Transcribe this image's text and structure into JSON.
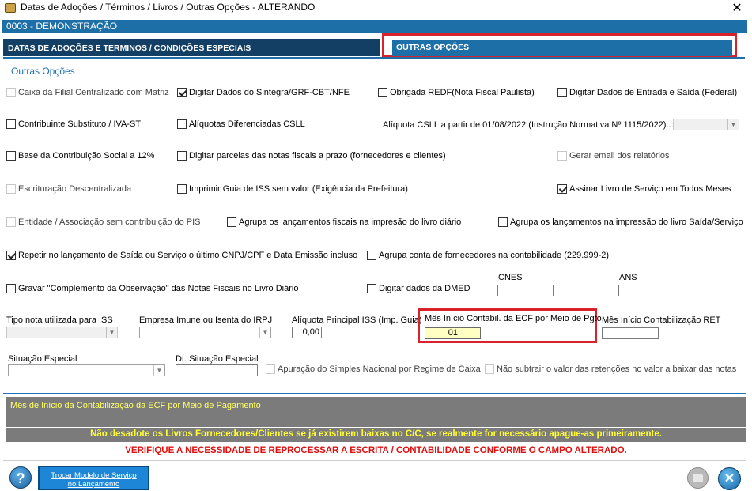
{
  "window": {
    "title": "Datas de Adoções / Términos / Livros / Outras Opções   -   ALTERANDO",
    "close_glyph": "✕"
  },
  "company_bar": "0003   -   DEMONSTRAÇÃO",
  "tabs": [
    {
      "label": "DATAS DE ADOÇÕES E TERMINOS / CONDIÇÕES ESPECIAIS"
    },
    {
      "label": "OUTRAS OPÇÕES"
    }
  ],
  "section_title": "Outras Opções",
  "checkboxes": {
    "caixa_filial": {
      "label": "Caixa da Filial Centralizado com Matriz",
      "checked": false,
      "enabled": false
    },
    "sintegra": {
      "label": "Digitar Dados do Sintegra/GRF-CBT/NFE",
      "checked": true,
      "enabled": true
    },
    "redf": {
      "label": "Obrigada REDF(Nota Fiscal Paulista)",
      "checked": false,
      "enabled": true
    },
    "entrada_saida": {
      "label": "Digitar Dados de Entrada e Saída (Federal)",
      "checked": false,
      "enabled": true
    },
    "contribuinte": {
      "label": "Contribuinte Substituto / IVA-ST",
      "checked": false,
      "enabled": true
    },
    "aliquotas_csll": {
      "label": "Alíquotas Diferenciadas CSLL",
      "checked": false,
      "enabled": true
    },
    "base_contrib": {
      "label": "Base da Contribuição Social a 12%",
      "checked": false,
      "enabled": true
    },
    "parcelas": {
      "label": "Digitar parcelas das notas fiscais a prazo (fornecedores e clientes)",
      "checked": false,
      "enabled": true
    },
    "gerar_email": {
      "label": "Gerar email dos relatórios",
      "checked": false,
      "enabled": false
    },
    "escrituracao": {
      "label": "Escrituração Descentralizada",
      "checked": false,
      "enabled": false
    },
    "guia_iss": {
      "label": "Imprimir Guia de ISS sem valor (Exigência da Prefeitura)",
      "checked": false,
      "enabled": true
    },
    "assinar_livro": {
      "label": "Assinar Livro de Serviço em Todos Meses",
      "checked": true,
      "enabled": true
    },
    "entidade": {
      "label": "Entidade / Associação sem contribuição do PIS",
      "checked": false,
      "enabled": false
    },
    "agrupa_fiscais": {
      "label": "Agrupa os lançamentos fiscais na impresão do livro diário",
      "checked": false,
      "enabled": true
    },
    "agrupa_saida": {
      "label": "Agrupa os lançamentos na impressão do livro Saída/Serviço",
      "checked": false,
      "enabled": true
    },
    "repetir": {
      "label": "Repetir no lançamento de Saída ou Serviço o último CNPJ/CPF e Data Emissão incluso",
      "checked": true,
      "enabled": true
    },
    "agrupa_conta": {
      "label": "Agrupa conta de fornecedores na contabilidade (229.999-2)",
      "checked": false,
      "enabled": true
    },
    "gravar_compl": {
      "label": "Gravar \"Complemento da Observação\" das Notas Fiscais no Livro Diário",
      "checked": false,
      "enabled": true
    },
    "dmed": {
      "label": "Digitar dados da DMED",
      "checked": false,
      "enabled": true
    },
    "apuracao": {
      "label": "Apuração do Simples Nacional por Regime de Caixa",
      "checked": false,
      "enabled": false
    },
    "nao_subtrair": {
      "label": "Não subtrair o valor das retenções no valor a baixar das notas",
      "checked": false,
      "enabled": false
    }
  },
  "fields": {
    "aliquota_csll_label": "Alíquota CSLL a partir de 01/08/2022 (Instrução Normativa Nº 1115/2022)..:",
    "cnes_label": "CNES",
    "ans_label": "ANS",
    "tipo_nota_label": "Tipo nota utilizada para ISS",
    "empresa_imune_label": "Empresa Imune ou Isenta do IRPJ",
    "aliquota_iss_label": "Alíquota Principal ISS (Imp. Guia)",
    "aliquota_iss_value": "0,00",
    "mes_ecf_label": "Mês Início Contabil. da ECF por Meio de Pgto.",
    "mes_ecf_value": "01",
    "mes_ret_label": "Mês Início Contabilização RET",
    "situacao_label": "Situação Especial",
    "dt_situacao_label": "Dt. Situação Especial"
  },
  "info_panel": {
    "hint": "Mês de Início da Contabilização da ECF por Meio de Pagamento",
    "warning_yellow": "Não desadote os Livros Fornecedores/Clientes se já existirem baixas no C/C, se realmente for necessário apague-as primeiramente.",
    "warning_red": "VERIFIQUE A NECESSIDADE DE REPROCESSAR A ESCRITA / CONTABILIDADE CONFORME O CAMPO ALTERADO."
  },
  "buttons": {
    "help": "?",
    "trocar_line1": "Trocar Modelo de Serviço",
    "trocar_line2": "no Lançamento",
    "close": "✕"
  },
  "icons": [
    "app-icon",
    "help-icon",
    "print-icon",
    "close-icon",
    "chevron-down-icon"
  ],
  "colors": {
    "accent_blue": "#1d6fa8",
    "dark_tab": "#123f63",
    "highlight_red": "#d9222a",
    "warning_yellow": "#ffff33",
    "warning_red": "#e01010",
    "panel_gray": "#7b7b7b"
  }
}
